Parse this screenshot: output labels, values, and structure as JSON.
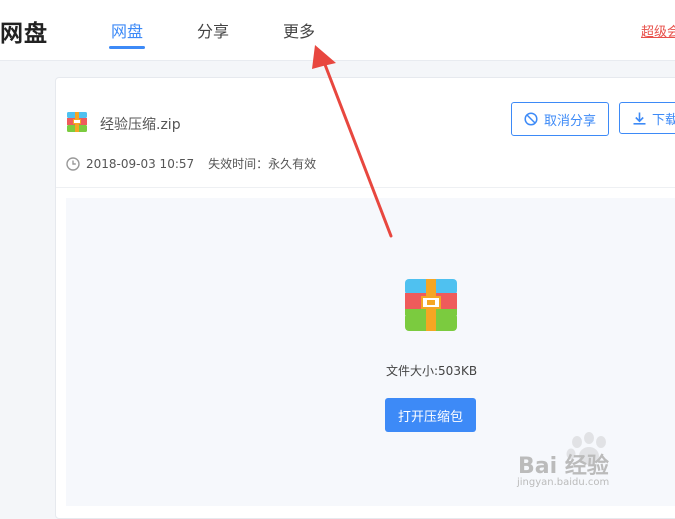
{
  "header": {
    "brand": "网盘",
    "tabs": [
      {
        "label": "网盘",
        "active": true
      },
      {
        "label": "分享",
        "active": false
      },
      {
        "label": "更多",
        "active": false
      }
    ],
    "super_link": "超级会"
  },
  "file": {
    "name": "经验压缩.zip",
    "date": "2018-09-03 10:57",
    "expiry": "失效时间：永久有效",
    "size": "文件大小:503KB"
  },
  "actions": {
    "cancel_share": "取消分享",
    "download": "下载",
    "open_archive": "打开压缩包"
  },
  "watermark": {
    "text": "Bai 经验",
    "url": "jingyan.baidu.com"
  },
  "colors": {
    "accent": "#3d8af7",
    "arrow": "#e8473f",
    "link_red": "#e8504a"
  }
}
